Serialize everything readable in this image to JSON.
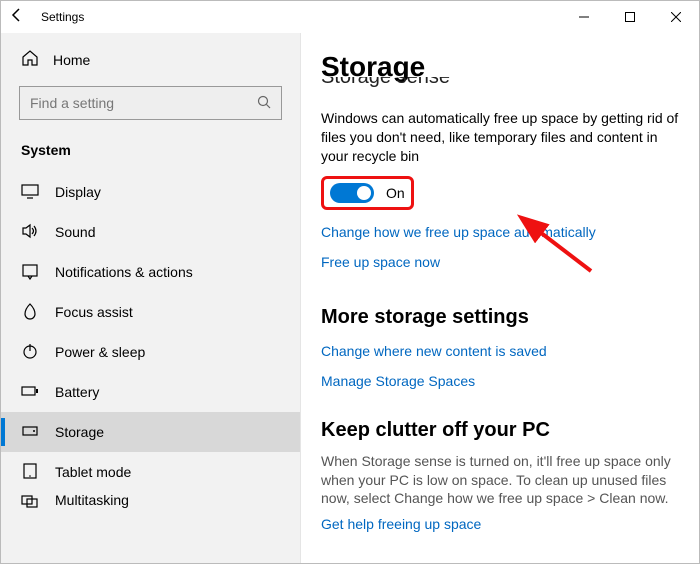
{
  "titlebar": {
    "title": "Settings"
  },
  "sidebar": {
    "home_label": "Home",
    "search_placeholder": "Find a setting",
    "category": "System",
    "items": [
      {
        "label": "Display"
      },
      {
        "label": "Sound"
      },
      {
        "label": "Notifications & actions"
      },
      {
        "label": "Focus assist"
      },
      {
        "label": "Power & sleep"
      },
      {
        "label": "Battery"
      },
      {
        "label": "Storage"
      },
      {
        "label": "Tablet mode"
      },
      {
        "label": "Multitasking"
      }
    ]
  },
  "main": {
    "page_title": "Storage",
    "cutoff_heading": "Storage sense",
    "sense_desc": "Windows can automatically free up space by getting rid of files you don't need, like temporary files and content in your recycle bin",
    "toggle_label": "On",
    "link_change_auto": "Change how we free up space automatically",
    "link_free_now": "Free up space now",
    "more_heading": "More storage settings",
    "link_change_save": "Change where new content is saved",
    "link_manage_spaces": "Manage Storage Spaces",
    "keep_heading": "Keep clutter off your PC",
    "keep_desc": "When Storage sense is turned on, it'll free up space only when your PC is low on space. To clean up unused files now, select Change how we free up space > Clean now.",
    "link_get_help": "Get help freeing up space"
  }
}
